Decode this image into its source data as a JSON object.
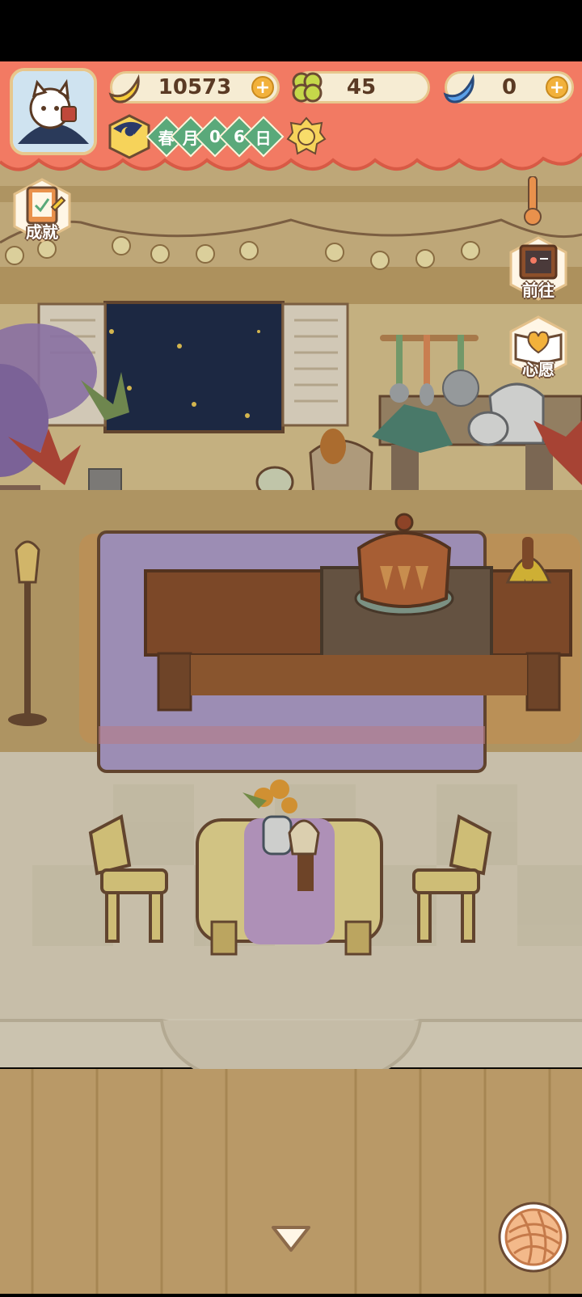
{
  "currencies": {
    "banana": {
      "value": "10573",
      "icon": "banana-icon"
    },
    "clover": {
      "value": "45",
      "icon": "clover-icon"
    },
    "blue_banana": {
      "value": "0",
      "icon": "blue-banana-icon"
    }
  },
  "calendar": {
    "season": "春",
    "month_char": "月",
    "day_digit1": "0",
    "day_digit2": "6",
    "day_char": "日",
    "weather": "sunny"
  },
  "side_buttons": {
    "achievements": "成就",
    "goto": "前往",
    "wish": "心愿"
  },
  "colors": {
    "banner": "#f27a63",
    "wall": "#ecd39a",
    "night_window": "#17284b",
    "rug": "#b2a3d6",
    "floor": "#f2ead8"
  }
}
